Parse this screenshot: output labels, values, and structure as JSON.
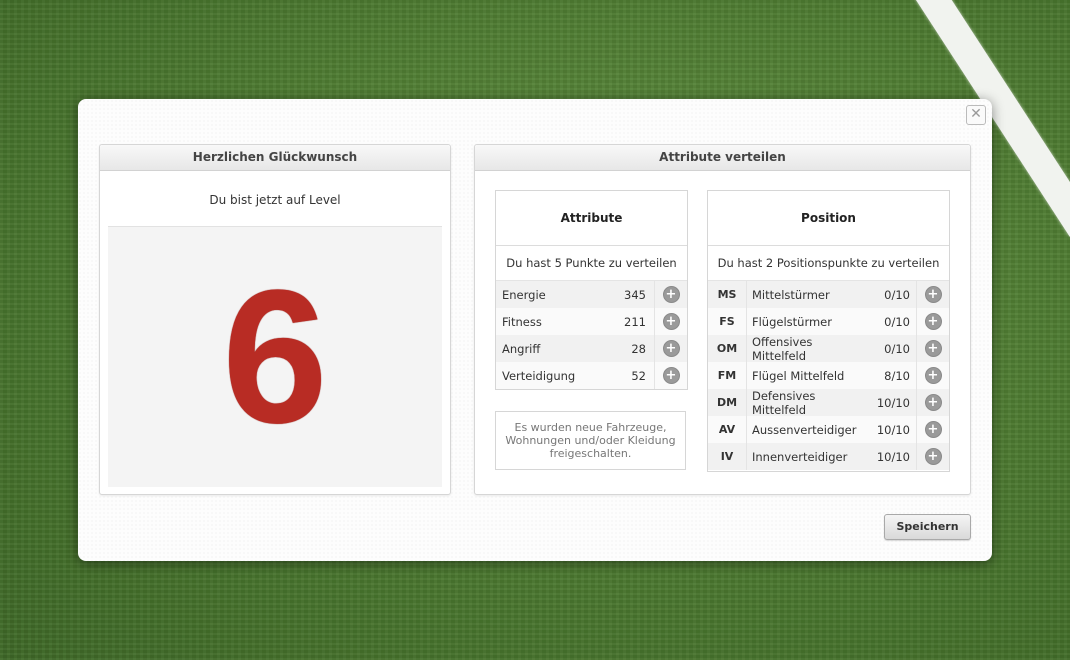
{
  "modal": {
    "close_label": "✕",
    "save_label": "Speichern"
  },
  "congrats": {
    "title": "Herzlichen Glückwunsch",
    "level_text": "Du bist jetzt auf Level",
    "level": "6"
  },
  "distribute": {
    "title": "Attribute verteilen",
    "attributes": {
      "title": "Attribute",
      "info": "Du hast 5 Punkte zu verteilen",
      "rows": [
        {
          "name": "Energie",
          "value": "345"
        },
        {
          "name": "Fitness",
          "value": "211"
        },
        {
          "name": "Angriff",
          "value": "28"
        },
        {
          "name": "Verteidigung",
          "value": "52"
        }
      ]
    },
    "notice": "Es wurden neue Fahrzeuge, Wohnungen und/oder Kleidung freigeschalten.",
    "position": {
      "title": "Position",
      "info": "Du hast 2 Positionspunkte zu verteilen",
      "rows": [
        {
          "abbr": "MS",
          "name": "Mittelstürmer",
          "value": "0/10"
        },
        {
          "abbr": "FS",
          "name": "Flügelstürmer",
          "value": "0/10"
        },
        {
          "abbr": "OM",
          "name": "Offensives Mittelfeld",
          "value": "0/10"
        },
        {
          "abbr": "FM",
          "name": "Flügel Mittelfeld",
          "value": "8/10"
        },
        {
          "abbr": "DM",
          "name": "Defensives Mittelfeld",
          "value": "10/10"
        },
        {
          "abbr": "AV",
          "name": "Aussenverteidiger",
          "value": "10/10"
        },
        {
          "abbr": "IV",
          "name": "Innenverteidiger",
          "value": "10/10"
        }
      ]
    }
  },
  "icons": {
    "plus": "+"
  },
  "colors": {
    "level_red": "#b82c24"
  }
}
